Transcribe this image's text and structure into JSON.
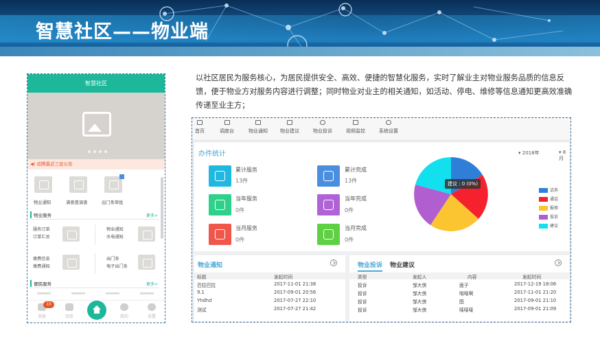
{
  "banner": {
    "title": "智慧社区——物业端"
  },
  "phone": {
    "header": "智慧社区",
    "notice": "如腾最近三层公告",
    "icons": [
      {
        "label": "物业通知"
      },
      {
        "label": "满意度调查"
      },
      {
        "label": "出门条审批"
      }
    ],
    "property_service": {
      "title": "物业服务",
      "more": "更多>"
    },
    "services": [
      {
        "line1": "服务订单",
        "line2": "订单汇总"
      },
      {
        "line1": "物业通知",
        "line2": "水电通知"
      },
      {
        "line1": "缴费信息",
        "line2": "缴费通知"
      },
      {
        "line1": "出门条",
        "line2": "电子出门条"
      }
    ],
    "resident_service": {
      "title": "便民服务",
      "more": "更多>"
    },
    "tabs": [
      {
        "label": "消息",
        "badge": "10"
      },
      {
        "label": "动态"
      },
      {
        "label": "我的"
      },
      {
        "label": "设置"
      }
    ]
  },
  "description": "以社区居民为服务核心，为居民提供安全、高效、便捷的智慧化服务，实时了解业主对物业服务品质的信息反馈，便于物业方对服务内容进行调整；同时物业对业主的相关通知，如活动、停电、维修等信息通知更高效准确传递至业主方；",
  "dashboard": {
    "nav": [
      "首页",
      "调度台",
      "物业通知",
      "物业建议",
      "物业投诉",
      "视频监控",
      "系统设置"
    ],
    "stats_title": "办件统计",
    "year": "2018年",
    "month": "8月",
    "stats": [
      {
        "label": "累计服务",
        "value": "13件",
        "color": "#1fb8e0"
      },
      {
        "label": "累计完成",
        "value": "13件",
        "color": "#4a8ee0"
      },
      {
        "label": "当年服务",
        "value": "0件",
        "color": "#2ed18a"
      },
      {
        "label": "当年完成",
        "value": "0件",
        "color": "#b063d6"
      },
      {
        "label": "当月服务",
        "value": "0件",
        "color": "#f0564a"
      },
      {
        "label": "当月完成",
        "value": "0件",
        "color": "#5fcf43"
      }
    ],
    "tooltip": "建议 : 0 (0%)",
    "legend": [
      {
        "name": "话务",
        "color": "#2f7ed8"
      },
      {
        "name": "通话",
        "color": "#f5222d"
      },
      {
        "name": "报修",
        "color": "#fbc531"
      },
      {
        "name": "投诉",
        "color": "#b15fd0"
      },
      {
        "name": "建议",
        "color": "#12e0ee"
      }
    ],
    "notice_panel": {
      "title": "物业通知",
      "headers": [
        "标题",
        "发起时间"
      ],
      "rows": [
        [
          "巴拉巴拉",
          "2017-11-01 21:38"
        ],
        [
          "9.1",
          "2017-09-01 20:56"
        ],
        [
          "Yhdhd",
          "2017-07-27 22:10"
        ],
        [
          "测试",
          "2017-07-27 21:42"
        ]
      ]
    },
    "complaint_panel": {
      "tab_active": "物业投诉",
      "tab_other": "物业建议",
      "headers": [
        "类型",
        "发起人",
        "内容",
        "发起时间"
      ],
      "rows": [
        [
          "投诉",
          "邹大侠",
          "面子",
          "2017-12-19 18:06"
        ],
        [
          "投诉",
          "邹大侠",
          "嗡嗡啊",
          "2017-11-01 21:20"
        ],
        [
          "投诉",
          "邹大侠",
          "图",
          "2017-09-01 21:10"
        ],
        [
          "投诉",
          "邹大侠",
          "唛唛唛",
          "2017-09-01 21:09"
        ]
      ]
    }
  }
}
